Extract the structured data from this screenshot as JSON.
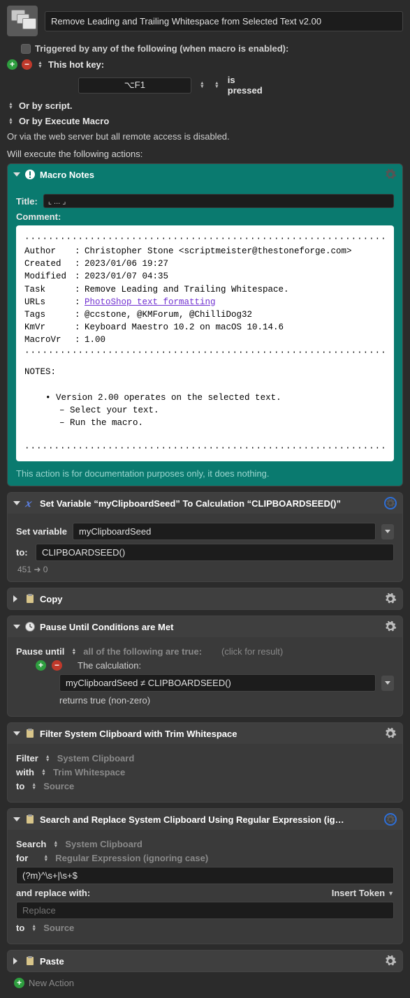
{
  "header": {
    "title": "Remove Leading and Trailing Whitespace from Selected Text v2.00"
  },
  "triggers": {
    "triggered_by": "Triggered by any of the following (when macro is enabled):",
    "this_hot_key": "This hot key:",
    "hotkey_value": "⌥F1",
    "is_pressed": "is pressed",
    "or_by_script": "Or by script.",
    "or_by_execute_macro": "Or by Execute Macro",
    "or_via_web": "Or via the web server but all remote access is disabled."
  },
  "exec_label": "Will execute the following actions:",
  "macro_notes": {
    "header": "Macro Notes",
    "title_label": "Title:",
    "title_value": "⌞ ... ⌟",
    "comment_label": "Comment:",
    "dots": "·························································································",
    "author": {
      "k": "Author",
      "v": "Christopher Stone <scriptmeister@thestoneforge.com>"
    },
    "created": {
      "k": "Created",
      "v": "2023/01/06 19:27"
    },
    "modified": {
      "k": "Modified",
      "v": "2023/01/07 04:35"
    },
    "task": {
      "k": "Task",
      "v": "Remove Leading and Trailing Whitespace."
    },
    "urls": {
      "k": "URLs",
      "v": "PhotoShop text formatting"
    },
    "tags": {
      "k": "Tags",
      "v": "@ccstone, @KMForum, @ChilliDog32"
    },
    "kmvr": {
      "k": "KmVr",
      "v": "Keyboard Maestro 10.2 on macOS 10.14.6"
    },
    "macrovr": {
      "k": "MacroVr",
      "v": "1.00"
    },
    "notes_label": "NOTES:",
    "note_bullet": "Version 2.00 operates on the selected text.",
    "note_dash1": "Select your text.",
    "note_dash2": "Run the macro.",
    "footer": "This action is for documentation purposes only, it does nothing."
  },
  "set_variable": {
    "header": "Set Variable “myClipboardSeed” To Calculation “CLIPBOARDSEED()”",
    "set_variable_label": "Set variable",
    "variable_name": "myClipboardSeed",
    "to_label": "to:",
    "calculation": "CLIPBOARDSEED()",
    "result": "451 ➜ 0"
  },
  "copy": {
    "header": "Copy"
  },
  "pause": {
    "header": "Pause Until Conditions are Met",
    "pause_until": "Pause until",
    "all_true": "all of the following are true:",
    "click_result": "(click for result)",
    "the_calculation": "The calculation:",
    "expression": "myClipboardSeed ≠ CLIPBOARDSEED()",
    "returns": "returns true (non-zero)"
  },
  "filter": {
    "header": "Filter System Clipboard with Trim Whitespace",
    "filter_label": "Filter",
    "system_clipboard": "System Clipboard",
    "with_label": "with",
    "trim_whitespace": "Trim Whitespace",
    "to_label": "to",
    "source": "Source"
  },
  "search_replace": {
    "header": "Search and Replace System Clipboard Using Regular Expression (ignoring c…",
    "search_label": "Search",
    "system_clipboard": "System Clipboard",
    "for_label": "for",
    "regex_mode": "Regular Expression (ignoring case)",
    "pattern": "(?m)^\\s+|\\s+$",
    "replace_label": "and replace with:",
    "insert_token": "Insert Token",
    "replace_placeholder": "Replace",
    "to_label": "to",
    "source": "Source"
  },
  "paste": {
    "header": "Paste"
  },
  "new_action": "New Action"
}
